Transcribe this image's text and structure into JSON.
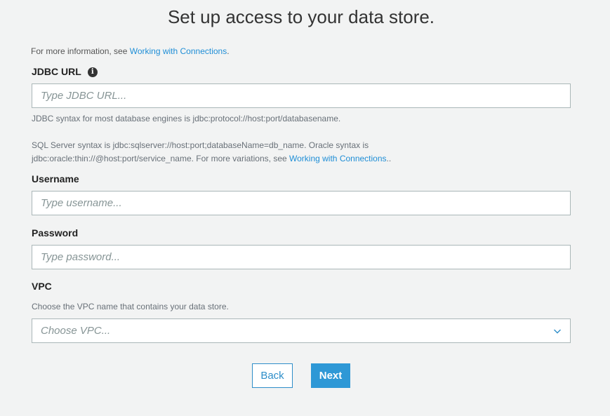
{
  "page": {
    "title": "Set up access to your data store."
  },
  "info": {
    "prefix": "For more information, see ",
    "link": "Working with Connections",
    "suffix": "."
  },
  "jdbc": {
    "label": "JDBC URL",
    "placeholder": "Type JDBC URL...",
    "value": "",
    "help1": "JDBC syntax for most database engines is jdbc:protocol://host:port/databasename.",
    "help2_line1": "SQL Server syntax is jdbc:sqlserver://host:port;databaseName=db_name. Oracle syntax is",
    "help2_line2_prefix": "jdbc:oracle:thin://@host:port/service_name. For more variations, see ",
    "help2_link": "Working with Connections",
    "help2_suffix": ".."
  },
  "username": {
    "label": "Username",
    "placeholder": "Type username...",
    "value": ""
  },
  "password": {
    "label": "Password",
    "placeholder": "Type password...",
    "value": ""
  },
  "vpc": {
    "label": "VPC",
    "help": "Choose the VPC name that contains your data store.",
    "selected": "Choose VPC..."
  },
  "buttons": {
    "back": "Back",
    "next": "Next"
  },
  "icons": {
    "info": "info-icon",
    "chevron": "chevron-down-icon"
  },
  "colors": {
    "background": "#f2f3f3",
    "link": "#1f8ed6",
    "primary": "#2e98d6",
    "border": "#aab7b8"
  }
}
